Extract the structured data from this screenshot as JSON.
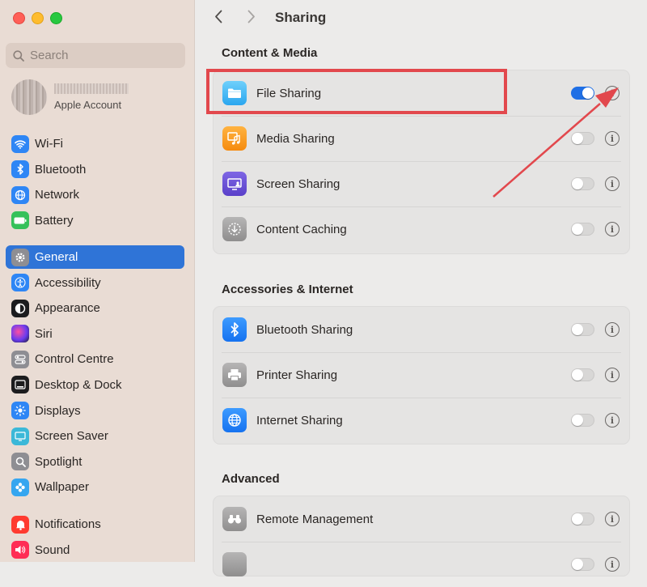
{
  "sidebar": {
    "search_placeholder": "Search",
    "account_label": "Apple Account",
    "items": [
      {
        "label": "Wi-Fi",
        "icon": "wifi-icon"
      },
      {
        "label": "Bluetooth",
        "icon": "bluetooth-icon"
      },
      {
        "label": "Network",
        "icon": "globe-icon"
      },
      {
        "label": "Battery",
        "icon": "battery-icon"
      },
      {
        "label": "General",
        "icon": "gear-icon",
        "selected": true
      },
      {
        "label": "Accessibility",
        "icon": "accessibility-icon"
      },
      {
        "label": "Appearance",
        "icon": "appearance-icon"
      },
      {
        "label": "Siri",
        "icon": "siri-icon"
      },
      {
        "label": "Control Centre",
        "icon": "control-centre-icon"
      },
      {
        "label": "Desktop & Dock",
        "icon": "dock-icon"
      },
      {
        "label": "Displays",
        "icon": "sun-icon"
      },
      {
        "label": "Screen Saver",
        "icon": "screensaver-icon"
      },
      {
        "label": "Spotlight",
        "icon": "magnifier-icon"
      },
      {
        "label": "Wallpaper",
        "icon": "flower-icon"
      },
      {
        "label": "Notifications",
        "icon": "bell-icon"
      },
      {
        "label": "Sound",
        "icon": "speaker-icon"
      }
    ]
  },
  "header": {
    "title": "Sharing"
  },
  "sections": [
    {
      "title": "Content & Media",
      "rows": [
        {
          "label": "File Sharing",
          "icon": "folder-icon",
          "on": true
        },
        {
          "label": "Media Sharing",
          "icon": "media-icon",
          "on": false
        },
        {
          "label": "Screen Sharing",
          "icon": "screen-sharing-icon",
          "on": false
        },
        {
          "label": "Content Caching",
          "icon": "caching-icon",
          "on": false
        }
      ]
    },
    {
      "title": "Accessories & Internet",
      "rows": [
        {
          "label": "Bluetooth Sharing",
          "icon": "bluetooth-icon",
          "on": false
        },
        {
          "label": "Printer Sharing",
          "icon": "printer-icon",
          "on": false
        },
        {
          "label": "Internet Sharing",
          "icon": "globe-icon",
          "on": false
        }
      ]
    },
    {
      "title": "Advanced",
      "rows": [
        {
          "label": "Remote Management",
          "icon": "binoculars-icon",
          "on": false
        }
      ]
    }
  ],
  "colors": {
    "accent": "#2f74d7",
    "toggle_on": "#1f6fe5",
    "annotation": "#e2484d"
  }
}
